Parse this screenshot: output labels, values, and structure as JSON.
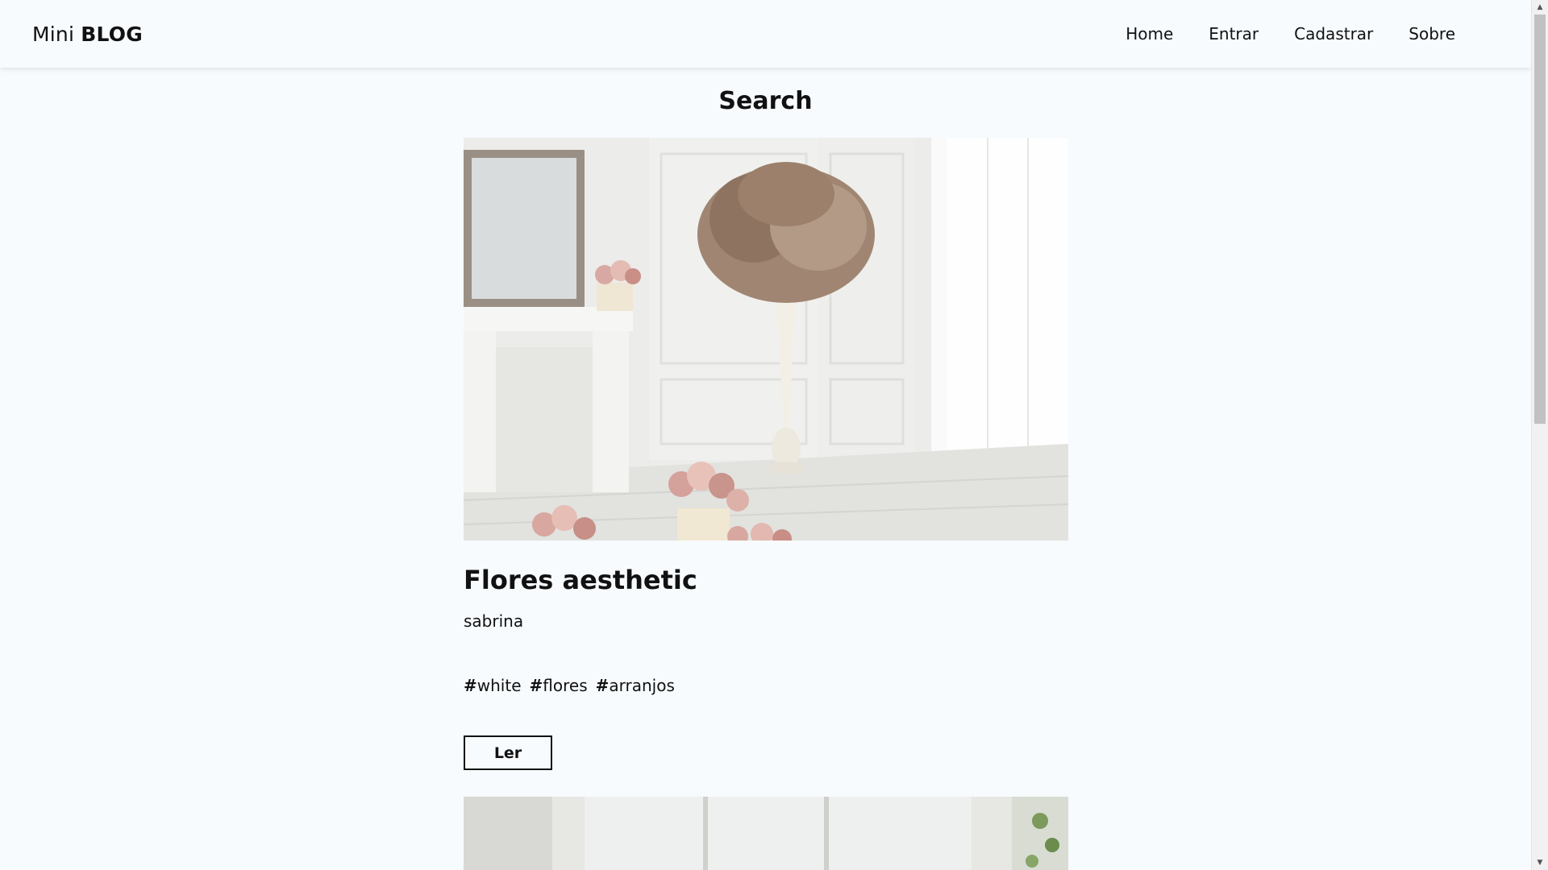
{
  "navbar": {
    "brand_light": "Mini ",
    "brand_bold": "BLOG",
    "links": [
      "Home",
      "Entrar",
      "Cadastrar",
      "Sobre"
    ]
  },
  "page": {
    "title": "Search"
  },
  "posts": [
    {
      "title": "Flores aesthetic",
      "author": "sabrina",
      "tags": [
        "white",
        "flores",
        "arranjos"
      ],
      "read_label": "Ler"
    }
  ],
  "tag_prefix": "#",
  "icons": {
    "scroll_up": "triangle-up-icon",
    "scroll_down": "triangle-down-icon"
  },
  "colors": {
    "background": "#f7fbfe",
    "text": "#111111"
  }
}
